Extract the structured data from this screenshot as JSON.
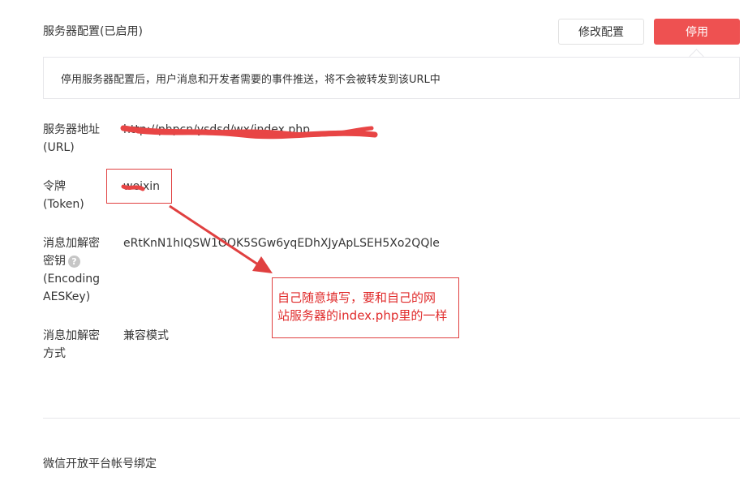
{
  "header": {
    "title": "服务器配置(已启用)",
    "edit_button": "修改配置",
    "disable_button": "停用"
  },
  "notice": {
    "text": "停用服务器配置后，用户消息和开发者需要的事件推送，将不会被转发到该URL中"
  },
  "fields": {
    "url": {
      "label_line1": "服务器地址",
      "label_line2": "(URL)",
      "value": "http://phpcn/ysdsd/wx/index.php"
    },
    "token": {
      "label_line1": "令牌",
      "label_line2": "(Token)",
      "value": "weixin"
    },
    "aeskey": {
      "label_line1": "消息加解密",
      "label_line2": "密钥",
      "label_line3": "(Encoding",
      "label_line4": "AESKey)",
      "value": "eRtKnN1hIQSW1OOK5SGw6yqEDhXJyApLSEH5Xo2QQle",
      "help_icon": "?"
    },
    "mode": {
      "label_line1": "消息加解密",
      "label_line2": "方式",
      "value": "兼容模式"
    }
  },
  "annotation": {
    "line1": "自己随意填写，要和自己的网",
    "line2": "站服务器的index.php里的一样"
  },
  "footer": {
    "open_platform_title": "微信开放平台帐号绑定"
  },
  "colors": {
    "primary_red": "#ee5151",
    "annotation_red": "#e02b2b",
    "border": "#e7e7eb",
    "text": "#353535"
  }
}
